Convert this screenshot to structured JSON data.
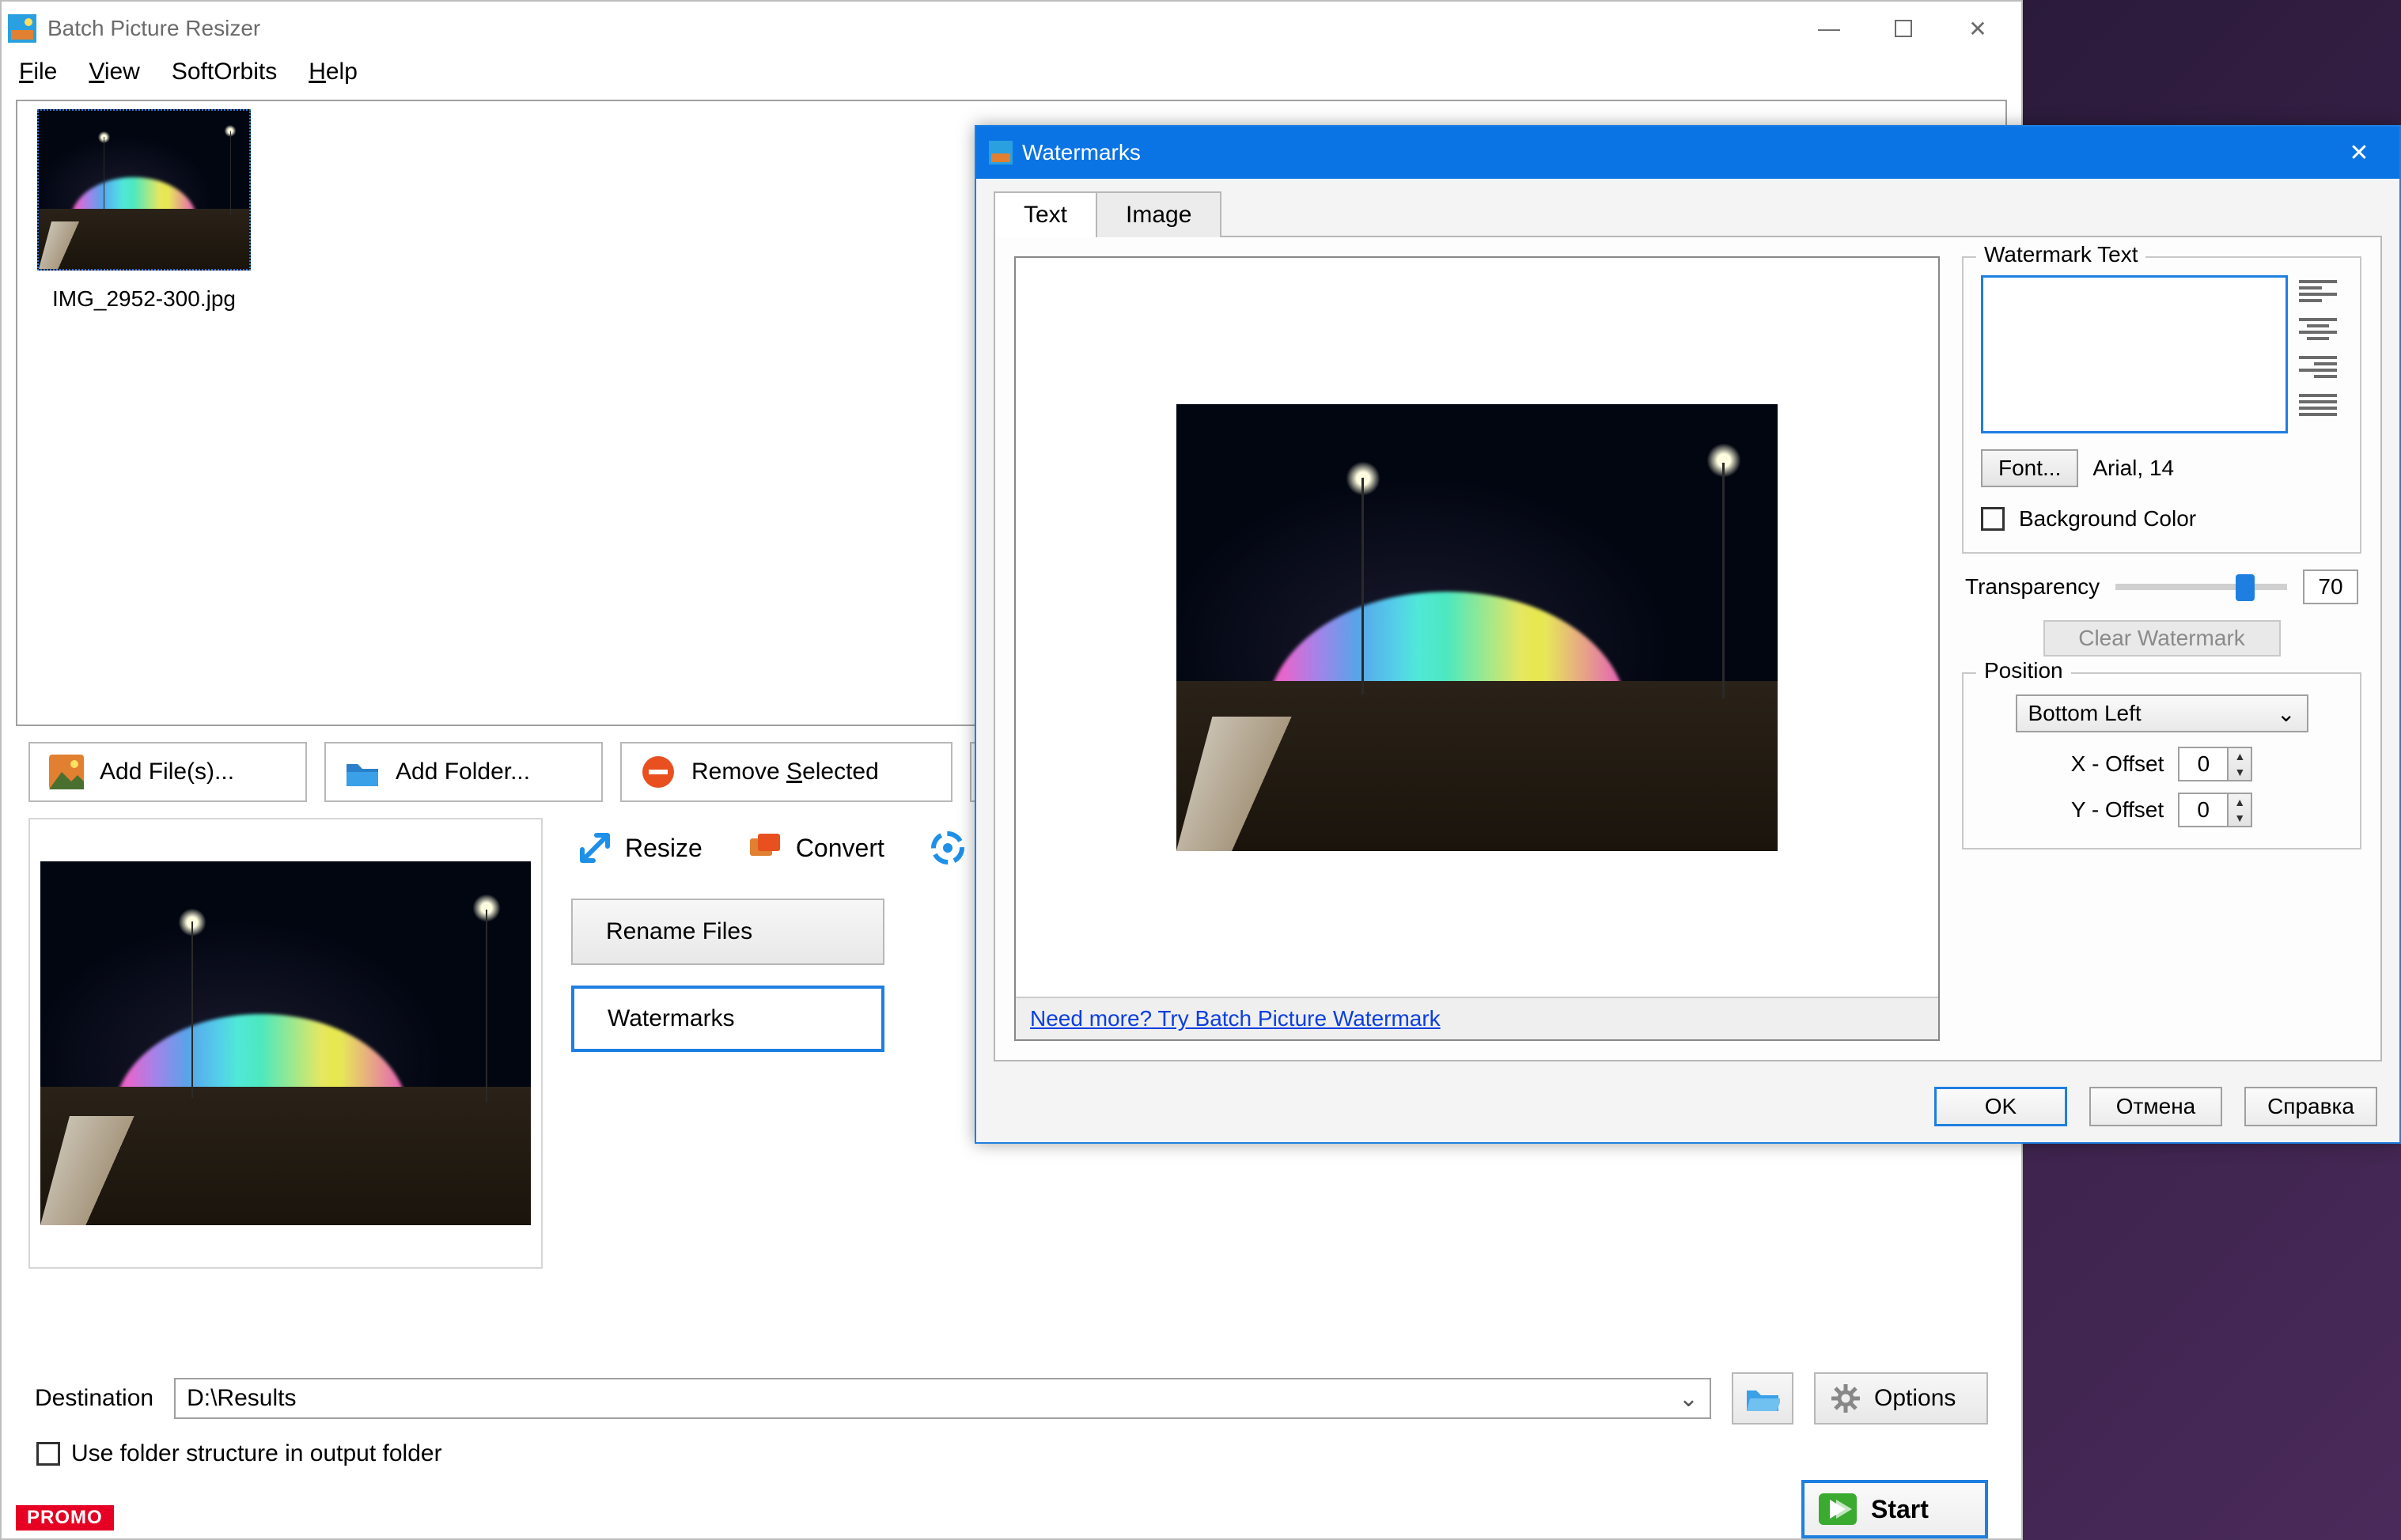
{
  "main": {
    "title": "Batch Picture Resizer",
    "menus": {
      "file": "File",
      "view": "View",
      "softorbits": "SoftOrbits",
      "help": "Help"
    },
    "thumb_name": "IMG_2952-300.jpg",
    "toolbar": {
      "add_files": "Add File(s)...",
      "add_folder": "Add Folder...",
      "remove_selected": "Remove Selected"
    },
    "op_tabs": {
      "resize": "Resize",
      "convert": "Convert"
    },
    "op_buttons": {
      "rename": "Rename Files",
      "watermarks": "Watermarks"
    },
    "destination_label": "Destination",
    "destination_value": "D:\\Results",
    "options": "Options",
    "use_folder_structure": "Use folder structure in output folder",
    "start": "Start",
    "promo": "PROMO"
  },
  "dialog": {
    "title": "Watermarks",
    "tabs": {
      "text": "Text",
      "image": "Image"
    },
    "link": "Need more? Try Batch Picture Watermark",
    "group_text": "Watermark Text",
    "font_btn": "Font...",
    "font_desc": "Arial, 14",
    "background_color": "Background Color",
    "transparency_label": "Transparency",
    "transparency_value": "70",
    "clear": "Clear Watermark",
    "group_position": "Position",
    "position_value": "Bottom Left",
    "x_offset_label": "X - Offset",
    "x_offset_value": "0",
    "y_offset_label": "Y - Offset",
    "y_offset_value": "0",
    "ok": "OK",
    "cancel": "Отмена",
    "help": "Справка"
  }
}
